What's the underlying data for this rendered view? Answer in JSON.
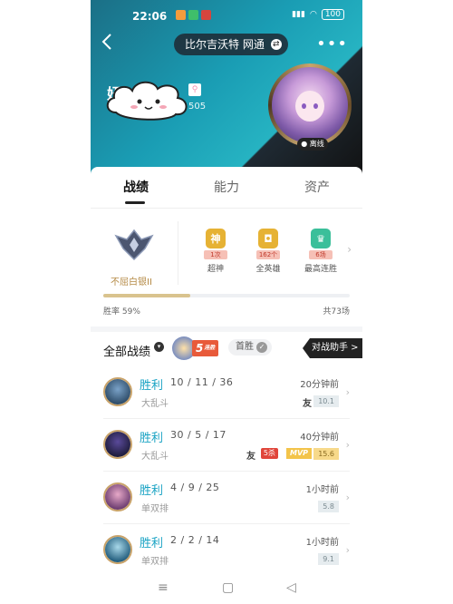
{
  "status_bar": {
    "time": "22:06",
    "battery": "100"
  },
  "header": {
    "server": "比尔吉沃特 网通",
    "player_name": "妞",
    "player_id": "505",
    "offline": "离线"
  },
  "tabs": [
    {
      "label": "战绩"
    },
    {
      "label": "能力"
    },
    {
      "label": "资产"
    }
  ],
  "rank": {
    "name": "不屈白银II",
    "medals": [
      {
        "tag": "1次",
        "label": "超神",
        "color": "#e6b234"
      },
      {
        "tag": "162个",
        "label": "全英雄",
        "color": "#e6b234"
      },
      {
        "tag": "6场",
        "label": "最高连胜",
        "color": "#3bbf9a"
      }
    ],
    "winrate_label": "胜率 59%",
    "winrate_value": 0.59,
    "total": "共73场"
  },
  "filter": {
    "all_label": "全部战绩",
    "streak_num": "5",
    "streak_suffix": "连胜",
    "first_win": "首胜",
    "assistant": "对战助手 >"
  },
  "matches": [
    {
      "result": "胜利",
      "kda": "10 / 11 / 36",
      "mode": "大乱斗",
      "time": "20分钟前",
      "score": "10.1",
      "friend": "友",
      "five_kill": "",
      "mvp": "",
      "gold": false,
      "avatar_colors": [
        "#2c4a66",
        "#7aa2c8"
      ]
    },
    {
      "result": "胜利",
      "kda": "30 / 5 / 17",
      "mode": "大乱斗",
      "time": "40分钟前",
      "score": "15.6",
      "friend": "友",
      "five_kill": "5杀",
      "mvp": "MVP",
      "gold": true,
      "avatar_colors": [
        "#1d1b3a",
        "#5a4a9a"
      ]
    },
    {
      "result": "胜利",
      "kda": "4 / 9 / 25",
      "mode": "单双排",
      "time": "1小时前",
      "score": "5.8",
      "friend": "",
      "five_kill": "",
      "mvp": "",
      "gold": false,
      "avatar_colors": [
        "#6a3a6e",
        "#e7a9c8"
      ]
    },
    {
      "result": "胜利",
      "kda": "2 / 2 / 14",
      "mode": "单双排",
      "time": "1小时前",
      "score": "9.1",
      "friend": "",
      "five_kill": "",
      "mvp": "",
      "gold": false,
      "avatar_colors": [
        "#1f5a7a",
        "#a9d9ea"
      ]
    }
  ]
}
